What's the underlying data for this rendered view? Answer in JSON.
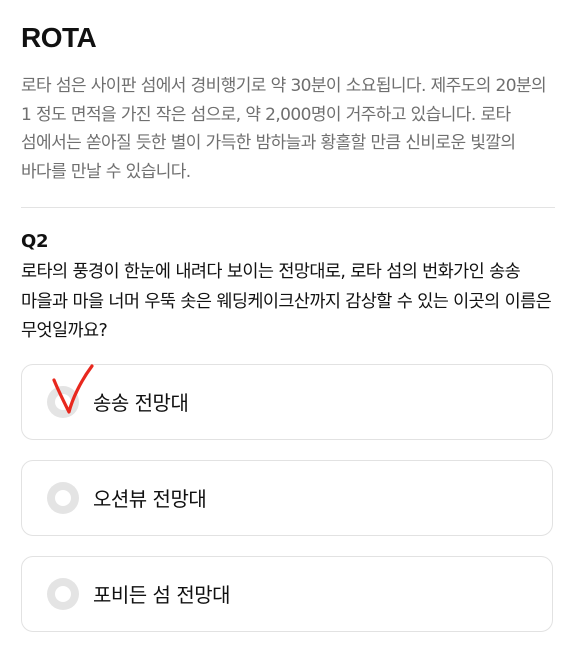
{
  "header": {
    "title": "ROTA",
    "description": "로타 섬은 사이판 섬에서 경비행기로 약 30분이 소요됩니다. 제주도의 20분의 1 정도 면적을 가진 작은 섬으로, 약 2,000명이 거주하고 있습니다. 로타 섬에서는 쏟아질 듯한 별이 가득한 밤하늘과 황홀할 만큼 신비로운 빛깔의 바다를 만날 수 있습니다."
  },
  "question": {
    "number": "Q2",
    "text": "로타의 풍경이 한눈에 내려다 보이는 전망대로, 로타 섬의 번화가인 송송 마을과 마을 너머 우뚝 솟은 웨딩케이크산까지 감상할 수 있는 이곳의 이름은 무엇일까요?"
  },
  "options": [
    {
      "label": "송송 전망대"
    },
    {
      "label": "오션뷰 전망대"
    },
    {
      "label": "포비든 섬 전망대"
    }
  ],
  "colors": {
    "radio": "#e4e4e4",
    "checkmark": "#e8281e",
    "description": "#6f6f6f",
    "border": "#e2e2e2"
  },
  "icons": {
    "handwritten_mark": "red-checkmark-icon"
  }
}
